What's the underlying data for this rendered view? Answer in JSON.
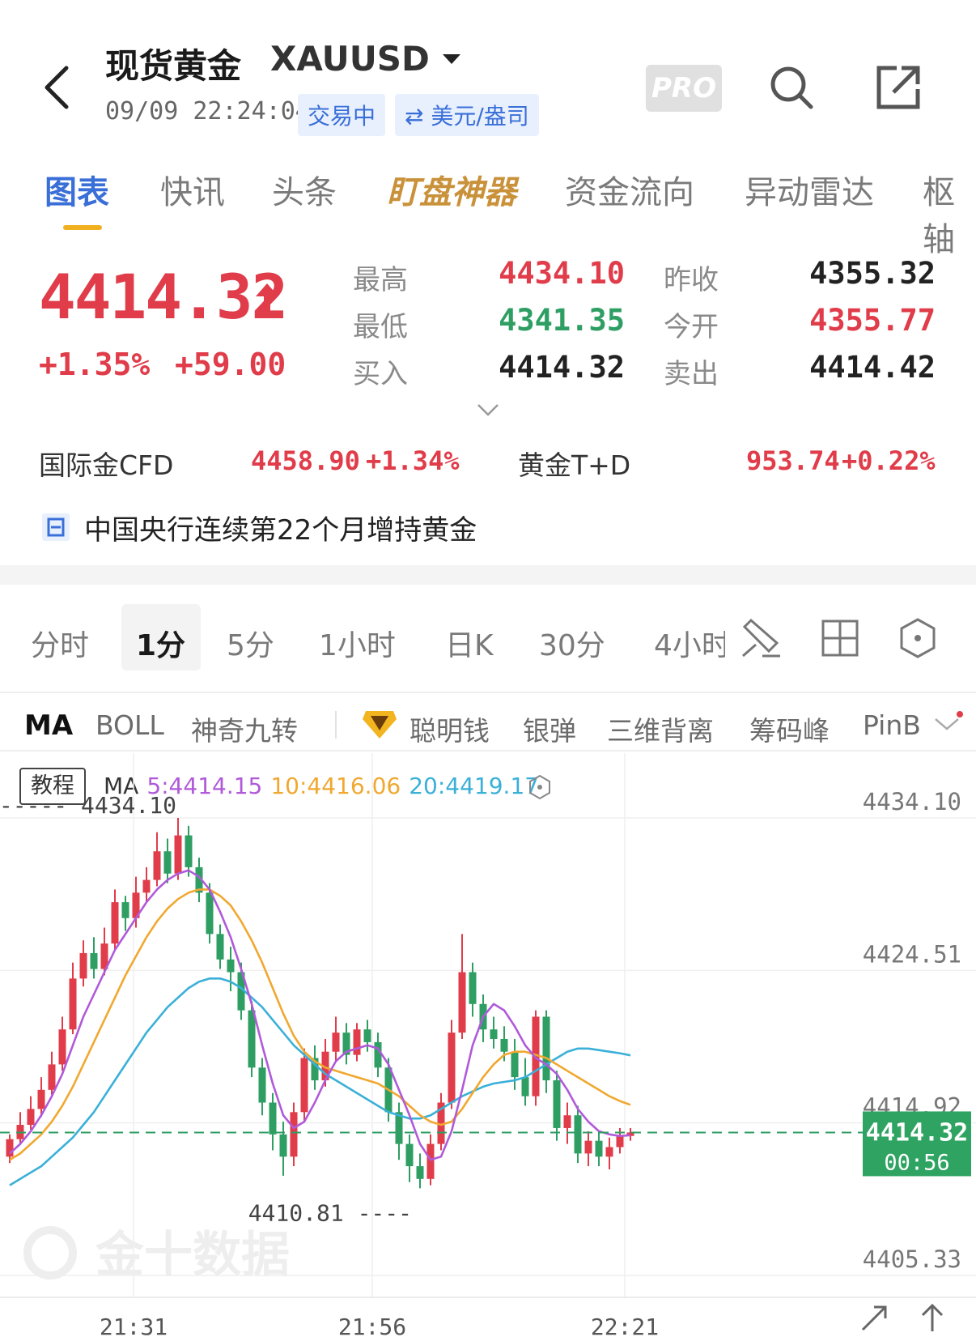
{
  "header": {
    "title": "现货黄金",
    "symbol": "XAUUSD",
    "datetime": "09/09 22:24:04",
    "status_chip": "交易中",
    "unit_chip": "⇄ 美元/盎司",
    "pro_badge": "PRO"
  },
  "tabs": [
    "图表",
    "快讯",
    "头条",
    "盯盘神器",
    "资金流向",
    "异动雷达",
    "枢轴"
  ],
  "quote": {
    "price": "4414.32",
    "change_pct": "+1.35%",
    "change_abs": "+59.00",
    "stats": [
      {
        "label": "最高",
        "value": "4434.10",
        "color": "red"
      },
      {
        "label": "昨收",
        "value": "4355.32",
        "color": "dark"
      },
      {
        "label": "最低",
        "value": "4341.35",
        "color": "green"
      },
      {
        "label": "今开",
        "value": "4355.77",
        "color": "red"
      },
      {
        "label": "买入",
        "value": "4414.32",
        "color": "dark"
      },
      {
        "label": "卖出",
        "value": "4414.42",
        "color": "dark"
      }
    ]
  },
  "related": [
    {
      "name": "国际金CFD",
      "price": "4458.90",
      "change": "+1.34%"
    },
    {
      "name": "黄金T+D",
      "price": "953.74",
      "change": "+0.22%"
    }
  ],
  "news": {
    "headline": "中国央行连续第22个月增持黄金"
  },
  "timeframes": [
    "分时",
    "1分",
    "5分",
    "1小时",
    "日K",
    "30分",
    "4小时"
  ],
  "active_timeframe": "1分",
  "indicators": [
    "MA",
    "BOLL",
    "神奇九转",
    "聪明钱",
    "银弹",
    "三维背离",
    "筹码峰",
    "PinB"
  ],
  "chart": {
    "tutorial": "教程",
    "ma_label": "MA",
    "ma5": "5:4414.15",
    "ma10": "10:4416.06",
    "ma20": "20:4419.17",
    "ma_colors": {
      "ma5": "#b05ad9",
      "ma10": "#f0a830",
      "ma20": "#3ab0d8"
    },
    "high_marker": "4434.10",
    "low_marker": "4410.81",
    "current_price": "4414.32",
    "countdown": "00:56",
    "watermark": "金十数据",
    "time_labels": [
      "21:31",
      "21:56",
      "22:21"
    ]
  },
  "chart_data": {
    "type": "candlestick",
    "y_ticks": [
      4434.1,
      4424.51,
      4414.92,
      4405.33
    ],
    "ylim": [
      4405.33,
      4434.1
    ],
    "current_price": 4414.32,
    "candles": [
      [
        4412.8,
        4413.9,
        4412.4,
        4414.2
      ],
      [
        4413.9,
        4414.8,
        4413.6,
        4415.6
      ],
      [
        4414.8,
        4415.8,
        4414.5,
        4416.6
      ],
      [
        4415.8,
        4417.0,
        4415.3,
        4417.8
      ],
      [
        4417.0,
        4418.6,
        4416.7,
        4419.4
      ],
      [
        4418.6,
        4420.8,
        4418.2,
        4421.6
      ],
      [
        4420.8,
        4424.0,
        4420.5,
        4425.0
      ],
      [
        4424.0,
        4425.6,
        4423.5,
        4426.4
      ],
      [
        4425.6,
        4424.6,
        4424.0,
        4426.6
      ],
      [
        4424.6,
        4426.2,
        4424.2,
        4427.2
      ],
      [
        4426.2,
        4428.8,
        4425.8,
        4429.6
      ],
      [
        4428.8,
        4427.8,
        4427.0,
        4429.2
      ],
      [
        4427.8,
        4429.4,
        4427.2,
        4430.4
      ],
      [
        4429.4,
        4430.2,
        4428.8,
        4431.0
      ],
      [
        4430.2,
        4432.0,
        4429.8,
        4433.2
      ],
      [
        4432.0,
        4430.6,
        4430.0,
        4432.8
      ],
      [
        4430.6,
        4433.0,
        4430.2,
        4434.1
      ],
      [
        4433.0,
        4431.0,
        4430.4,
        4433.6
      ],
      [
        4431.0,
        4429.4,
        4428.8,
        4431.6
      ],
      [
        4429.4,
        4426.8,
        4426.2,
        4430.0
      ],
      [
        4426.8,
        4425.2,
        4424.6,
        4427.4
      ],
      [
        4425.2,
        4424.4,
        4423.2,
        4426.0
      ],
      [
        4424.4,
        4422.0,
        4421.4,
        4425.0
      ],
      [
        4422.0,
        4418.4,
        4417.8,
        4422.6
      ],
      [
        4418.4,
        4416.2,
        4415.4,
        4419.0
      ],
      [
        4416.2,
        4414.2,
        4413.2,
        4416.8
      ],
      [
        4414.2,
        4412.8,
        4411.6,
        4415.0
      ],
      [
        4412.8,
        4415.6,
        4412.2,
        4416.2
      ],
      [
        4415.6,
        4419.0,
        4415.0,
        4419.6
      ],
      [
        4419.0,
        4417.6,
        4417.0,
        4419.8
      ],
      [
        4417.6,
        4419.4,
        4417.2,
        4420.2
      ],
      [
        4419.4,
        4420.6,
        4418.8,
        4421.6
      ],
      [
        4420.6,
        4419.2,
        4418.6,
        4421.2
      ],
      [
        4419.2,
        4420.8,
        4418.8,
        4421.2
      ],
      [
        4420.8,
        4420.0,
        4419.4,
        4421.4
      ],
      [
        4420.0,
        4418.4,
        4417.8,
        4420.6
      ],
      [
        4418.4,
        4415.6,
        4415.0,
        4419.0
      ],
      [
        4415.6,
        4413.6,
        4412.6,
        4416.2
      ],
      [
        4413.6,
        4412.2,
        4411.2,
        4414.2
      ],
      [
        4412.2,
        4411.4,
        4410.81,
        4413.0
      ],
      [
        4411.4,
        4413.6,
        4411.0,
        4414.2
      ],
      [
        4413.6,
        4416.2,
        4413.2,
        4416.8
      ],
      [
        4416.2,
        4420.6,
        4415.8,
        4421.4
      ],
      [
        4420.6,
        4424.4,
        4420.2,
        4426.8
      ],
      [
        4424.4,
        4422.4,
        4421.6,
        4425.0
      ],
      [
        4422.4,
        4420.8,
        4420.0,
        4423.0
      ],
      [
        4420.8,
        4420.2,
        4419.6,
        4421.6
      ],
      [
        4420.2,
        4419.4,
        4418.8,
        4421.0
      ],
      [
        4419.4,
        4417.8,
        4417.0,
        4420.2
      ],
      [
        4417.8,
        4416.6,
        4416.0,
        4419.0
      ],
      [
        4416.6,
        4421.6,
        4416.0,
        4422.0
      ],
      [
        4421.6,
        4417.6,
        4416.8,
        4422.0
      ],
      [
        4417.6,
        4414.6,
        4413.8,
        4418.2
      ],
      [
        4414.6,
        4415.4,
        4413.6,
        4416.2
      ],
      [
        4415.4,
        4413.0,
        4412.4,
        4416.0
      ],
      [
        4413.0,
        4413.8,
        4412.2,
        4414.4
      ],
      [
        4413.8,
        4412.8,
        4412.2,
        4414.4
      ],
      [
        4412.8,
        4413.4,
        4412.0,
        4414.0
      ],
      [
        4413.4,
        4414.1,
        4413.0,
        4414.6
      ],
      [
        4414.1,
        4414.32,
        4413.8,
        4414.6
      ]
    ]
  },
  "ma_series": {
    "ma5": [
      4413.0,
      4413.6,
      4414.4,
      4415.4,
      4416.6,
      4418.0,
      4419.8,
      4421.6,
      4423.0,
      4424.4,
      4425.8,
      4426.8,
      4427.8,
      4428.8,
      4429.6,
      4430.2,
      4430.6,
      4430.8,
      4430.4,
      4429.6,
      4428.2,
      4426.6,
      4424.6,
      4422.4,
      4419.8,
      4417.4,
      4415.4,
      4414.6,
      4415.0,
      4416.2,
      4417.6,
      4418.8,
      4419.4,
      4419.6,
      4419.8,
      4419.6,
      4418.6,
      4417.0,
      4415.4,
      4413.6,
      4412.6,
      4412.8,
      4414.4,
      4417.0,
      4419.8,
      4421.6,
      4422.4,
      4422.0,
      4421.0,
      4419.8,
      4419.0,
      4418.6,
      4418.0,
      4417.0,
      4415.8,
      4415.0,
      4414.4,
      4414.2,
      4414.1,
      4414.15
    ],
    "ma10": [
      4412.6,
      4413.0,
      4413.6,
      4414.2,
      4415.0,
      4416.0,
      4417.2,
      4418.6,
      4420.0,
      4421.4,
      4422.8,
      4424.2,
      4425.4,
      4426.6,
      4427.6,
      4428.4,
      4429.0,
      4429.4,
      4429.6,
      4429.6,
      4429.2,
      4428.6,
      4427.6,
      4426.4,
      4425.0,
      4423.4,
      4421.8,
      4420.4,
      4419.4,
      4418.8,
      4418.4,
      4418.2,
      4418.0,
      4417.8,
      4417.6,
      4417.4,
      4417.0,
      4416.6,
      4416.0,
      4415.4,
      4415.0,
      4414.8,
      4415.0,
      4415.8,
      4416.8,
      4417.8,
      4418.6,
      4419.2,
      4419.4,
      4419.4,
      4419.2,
      4419.0,
      4418.6,
      4418.2,
      4417.8,
      4417.4,
      4417.0,
      4416.6,
      4416.3,
      4416.06
    ],
    "ma20": [
      4411.0,
      4411.4,
      4411.8,
      4412.2,
      4412.8,
      4413.4,
      4414.0,
      4414.8,
      4415.6,
      4416.6,
      4417.6,
      4418.6,
      4419.6,
      4420.6,
      4421.4,
      4422.2,
      4422.8,
      4423.4,
      4423.8,
      4424.0,
      4424.0,
      4423.8,
      4423.4,
      4422.8,
      4422.2,
      4421.4,
      4420.6,
      4419.8,
      4419.2,
      4418.6,
      4418.0,
      4417.6,
      4417.2,
      4416.8,
      4416.4,
      4416.0,
      4415.6,
      4415.4,
      4415.2,
      4415.2,
      4415.4,
      4415.8,
      4416.2,
      4416.6,
      4416.9,
      4417.2,
      4417.4,
      4417.5,
      4417.6,
      4417.8,
      4418.2,
      4418.6,
      4419.0,
      4419.4,
      4419.6,
      4419.6,
      4419.5,
      4419.4,
      4419.3,
      4419.17
    ]
  }
}
